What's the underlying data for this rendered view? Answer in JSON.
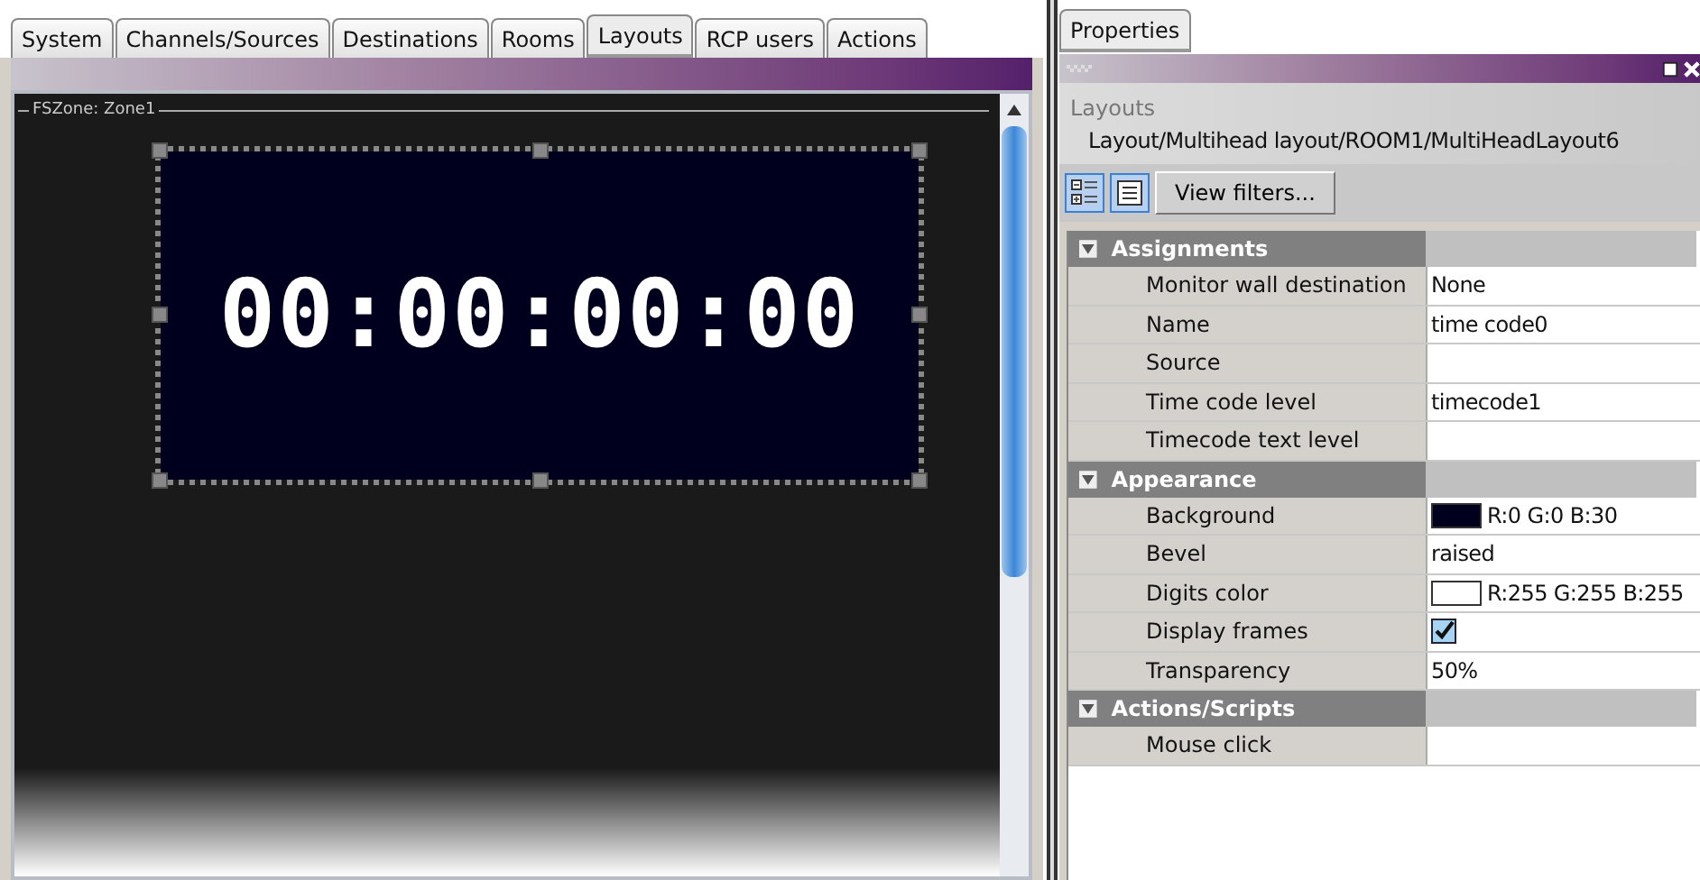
{
  "tabs": [
    {
      "label": "System",
      "selected": false
    },
    {
      "label": "Channels/Sources",
      "selected": false
    },
    {
      "label": "Destinations",
      "selected": false
    },
    {
      "label": "Rooms",
      "selected": false
    },
    {
      "label": "Layouts",
      "selected": true
    },
    {
      "label": "RCP users",
      "selected": false
    },
    {
      "label": "Actions",
      "selected": false
    }
  ],
  "zone": {
    "title": "FSZone: Zone1",
    "timecode": "00:00:00:00"
  },
  "properties": {
    "tab": "Properties",
    "section_label": "Layouts",
    "path": "Layout/Multihead layout/ROOM1/MultiHeadLayout6",
    "filter_button": "View filters...",
    "groups": [
      {
        "title": "Assignments",
        "expanded": true,
        "rows": [
          {
            "kind": "text",
            "label": "Monitor wall destination",
            "value": "None"
          },
          {
            "kind": "text",
            "label": "Name",
            "value": "time code0"
          },
          {
            "kind": "text",
            "label": "Source"
          },
          {
            "kind": "text",
            "label": "Time code level",
            "value": "timecode1"
          },
          {
            "kind": "text",
            "label": "Timecode text level"
          }
        ]
      },
      {
        "title": "Appearance",
        "expanded": true,
        "rows": [
          {
            "kind": "color",
            "label": "Background",
            "color": "#00001e",
            "value": "R:0 G:0 B:30"
          },
          {
            "kind": "text",
            "label": "Bevel",
            "value": "raised"
          },
          {
            "kind": "color",
            "label": "Digits color",
            "color": "#ffffff",
            "value": "R:255 G:255 B:255"
          },
          {
            "kind": "checkbox",
            "label": "Display frames",
            "checked": true
          },
          {
            "kind": "text",
            "label": "Transparency",
            "value": "50%"
          }
        ]
      },
      {
        "title": "Actions/Scripts",
        "expanded": true,
        "rows": [
          {
            "kind": "text",
            "label": "Mouse click"
          }
        ]
      }
    ]
  }
}
